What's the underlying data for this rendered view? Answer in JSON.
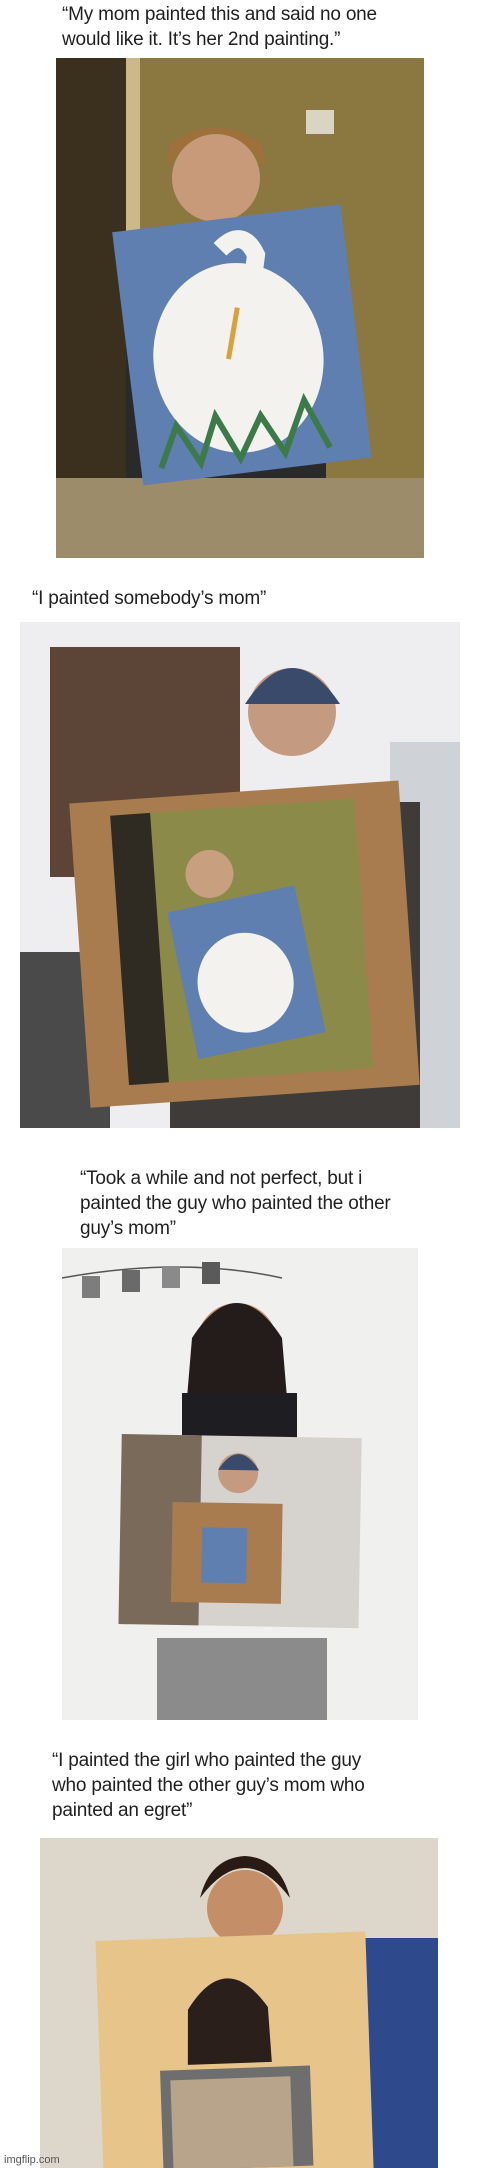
{
  "panels": [
    {
      "caption": "“My mom painted this and said no one\nwould like it. It’s her 2nd painting.”",
      "photo_icon": "woman-holding-egret-painting"
    },
    {
      "caption": "“I painted somebody’s mom”",
      "photo_icon": "man-holding-painting-of-mom"
    },
    {
      "caption": "“Took a while and not perfect, but i\npainted the guy who painted the other\nguy’s mom”",
      "photo_icon": "woman-holding-painting-of-man"
    },
    {
      "caption": "“I painted the girl who painted the guy\nwho painted the other guy’s mom who\npainted an egret”",
      "photo_icon": "man-holding-painting-of-girl"
    }
  ],
  "watermark": "imgflip.com",
  "colors": {
    "caption_text": "#1f1f1f",
    "background": "#ffffff"
  }
}
